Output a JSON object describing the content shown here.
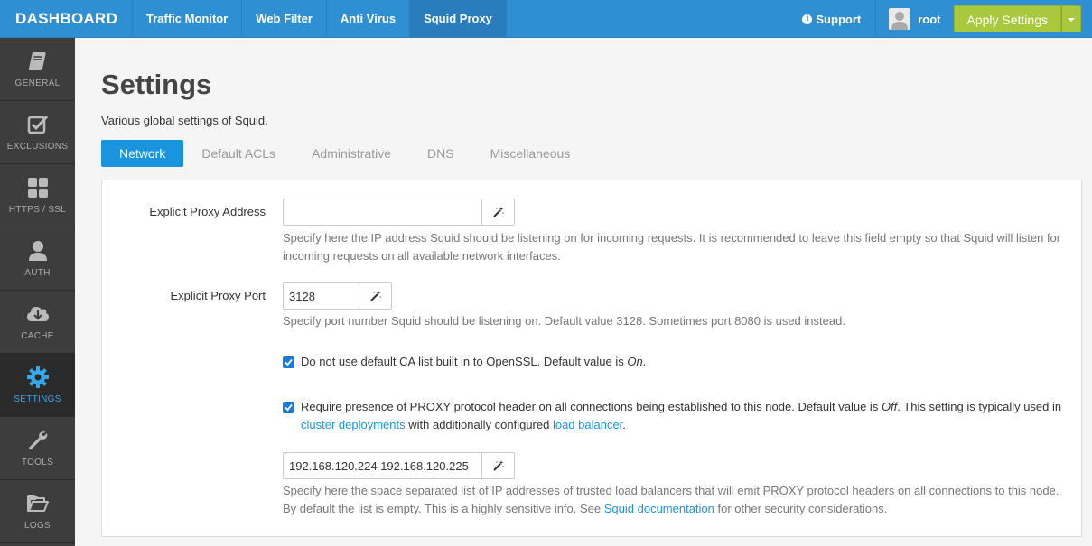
{
  "brand": "DASHBOARD",
  "nav": {
    "tabs": [
      {
        "label": "Traffic Monitor",
        "active": false
      },
      {
        "label": "Web Filter",
        "active": false
      },
      {
        "label": "Anti Virus",
        "active": false
      },
      {
        "label": "Squid Proxy",
        "active": true
      }
    ],
    "support_label": "Support",
    "user_name": "root",
    "apply_label": "Apply Settings"
  },
  "sidebar": {
    "items": [
      {
        "label": "GENERAL",
        "icon": "book-icon"
      },
      {
        "label": "EXCLUSIONS",
        "icon": "checkbox-icon"
      },
      {
        "label": "HTTPS / SSL",
        "icon": "grid-icon"
      },
      {
        "label": "AUTH",
        "icon": "user-icon"
      },
      {
        "label": "CACHE",
        "icon": "cloud-download-icon"
      },
      {
        "label": "SETTINGS",
        "icon": "gear-icon",
        "active": true
      },
      {
        "label": "TOOLS",
        "icon": "wrench-icon"
      },
      {
        "label": "LOGS",
        "icon": "folder-icon"
      }
    ]
  },
  "page": {
    "title": "Settings",
    "description": "Various global settings of Squid."
  },
  "tabs": [
    {
      "label": "Network",
      "active": true
    },
    {
      "label": "Default ACLs",
      "active": false
    },
    {
      "label": "Administrative",
      "active": false
    },
    {
      "label": "DNS",
      "active": false
    },
    {
      "label": "Miscellaneous",
      "active": false
    }
  ],
  "form": {
    "proxy_address": {
      "label": "Explicit Proxy Address",
      "value": "",
      "help": "Specify here the IP address Squid should be listening on for incoming requests. It is recommended to leave this field empty so that Squid will listen for incoming requests on all available network interfaces."
    },
    "proxy_port": {
      "label": "Explicit Proxy Port",
      "value": "3128",
      "help": "Specify port number Squid should be listening on. Default value 3128. Sometimes port 8080 is used instead."
    },
    "ca_list": {
      "checked": true,
      "text_before": "Do not use default CA list built in to OpenSSL. Default value is ",
      "text_em": "On",
      "text_after": "."
    },
    "proxy_protocol": {
      "checked": true,
      "text_before": "Require presence of PROXY protocol header on all connections being established to this node. Default value is ",
      "text_em": "Off",
      "text_mid": ". This setting is typically used in ",
      "link1": "cluster deployments",
      "text_mid2": " with additionally configured ",
      "link2": "load balancer",
      "text_after": "."
    },
    "load_balancers": {
      "value": "192.168.120.224 192.168.120.225",
      "help_before": "Specify here the space separated list of IP addresses of trusted load balancers that will emit PROXY protocol headers on all connections to this node. By default the list is empty. This is a highly sensitive info. See ",
      "help_link": "Squid documentation",
      "help_after": " for other security considerations."
    }
  },
  "colors": {
    "navbar": "#2f8fd3",
    "accent": "#1a95dd",
    "apply": "#a8c83d",
    "sidebar": "#3d3d3d"
  }
}
